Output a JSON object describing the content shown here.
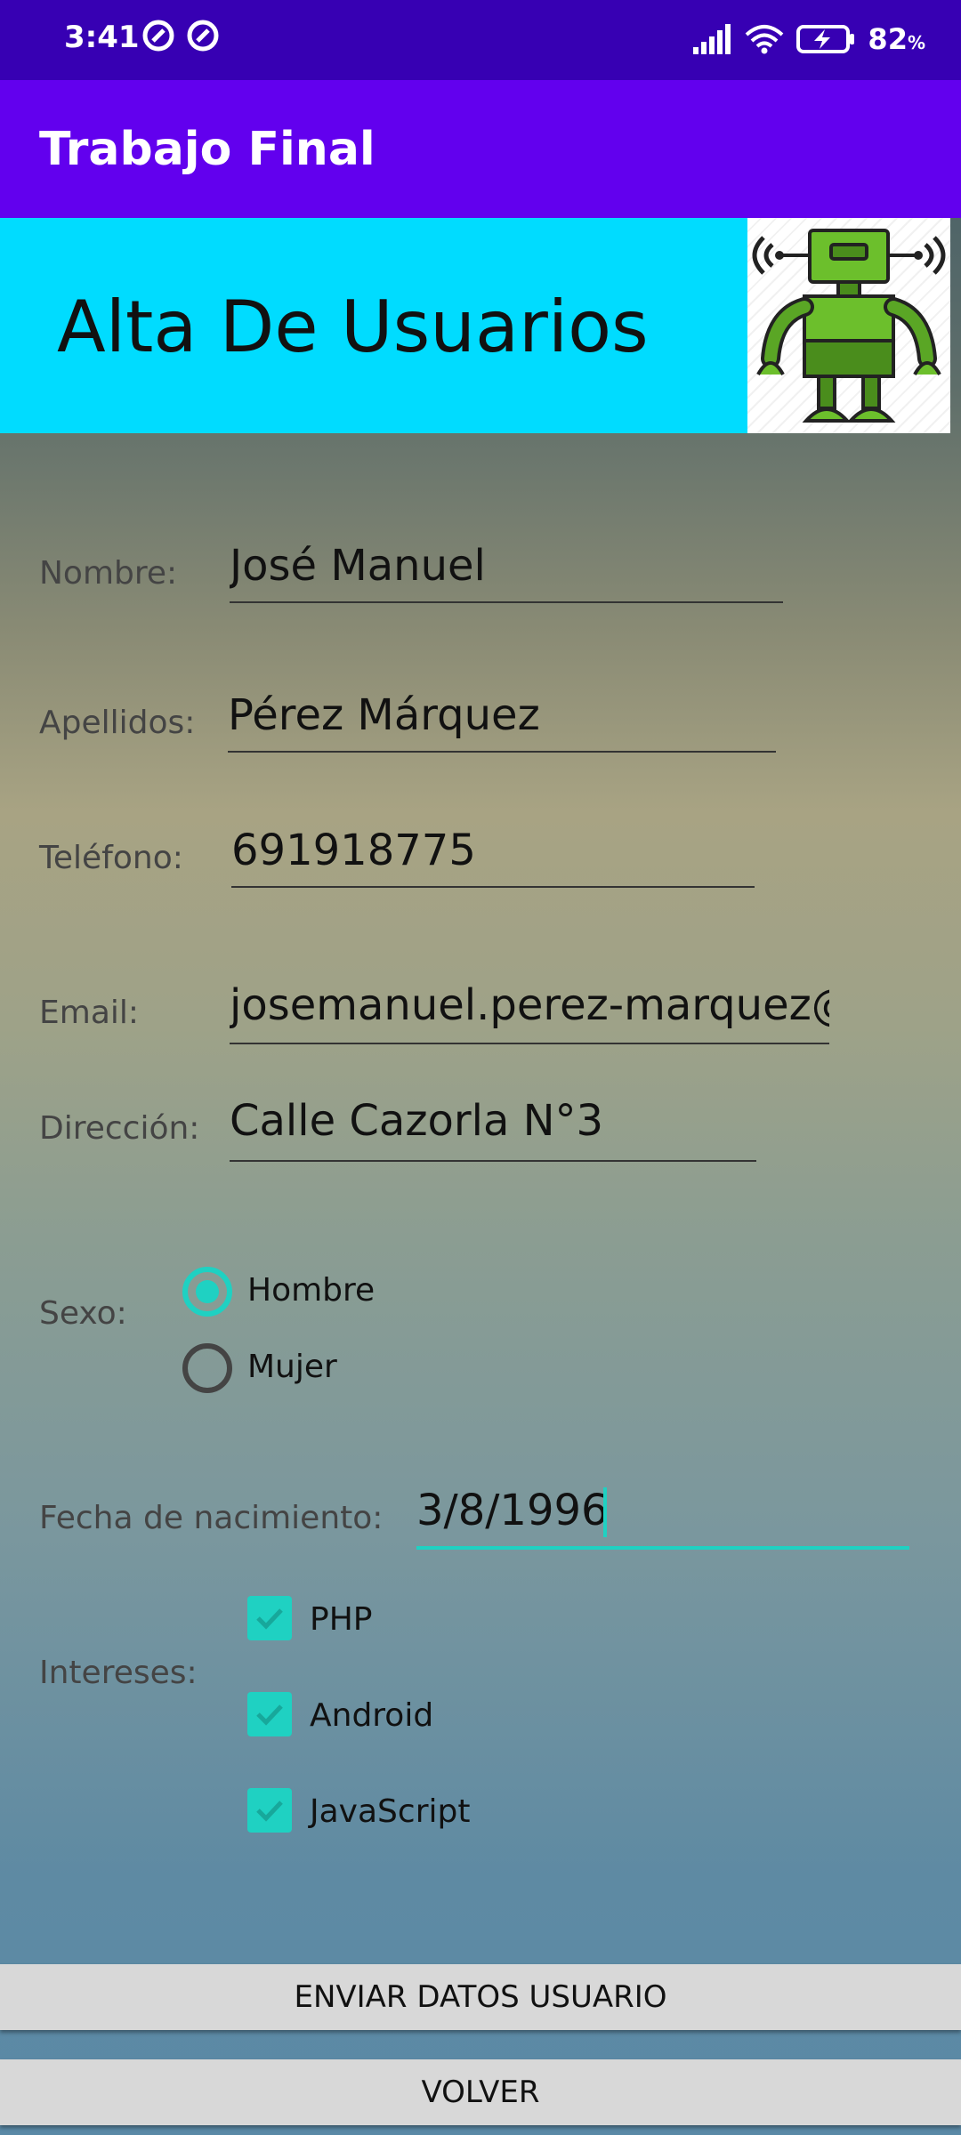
{
  "status_bar": {
    "time": "3:41",
    "battery": "82",
    "battery_unit": "%"
  },
  "app_bar": {
    "title": "Trabajo Final"
  },
  "banner": {
    "title": "Alta De Usuarios",
    "image_icon": "robot-icon"
  },
  "form": {
    "nombre": {
      "label": "Nombre:",
      "value": "José Manuel"
    },
    "apellidos": {
      "label": "Apellidos:",
      "value": "Pérez Márquez"
    },
    "telefono": {
      "label": "Teléfono:",
      "value": "691918775"
    },
    "email": {
      "label": "Email:",
      "value": "josemanuel.perez-marquez@ie"
    },
    "direccion": {
      "label": "Dirección:",
      "value": "Calle Cazorla N°3"
    },
    "sexo": {
      "label": "Sexo:",
      "options": [
        {
          "label": "Hombre",
          "checked": true
        },
        {
          "label": "Mujer",
          "checked": false
        }
      ]
    },
    "fecha": {
      "label": "Fecha de nacimiento:",
      "value": "3/8/1996"
    },
    "intereses": {
      "label": "Intereses:",
      "options": [
        {
          "label": "PHP",
          "checked": true
        },
        {
          "label": "Android",
          "checked": true
        },
        {
          "label": "JavaScript",
          "checked": true
        }
      ]
    }
  },
  "buttons": {
    "submit": "ENVIAR DATOS USUARIO",
    "back": "VOLVER"
  },
  "colors": {
    "status_bar": "#3700b3",
    "app_bar": "#6200ee",
    "banner": "#00dcff",
    "accent": "#1fd1c2"
  }
}
